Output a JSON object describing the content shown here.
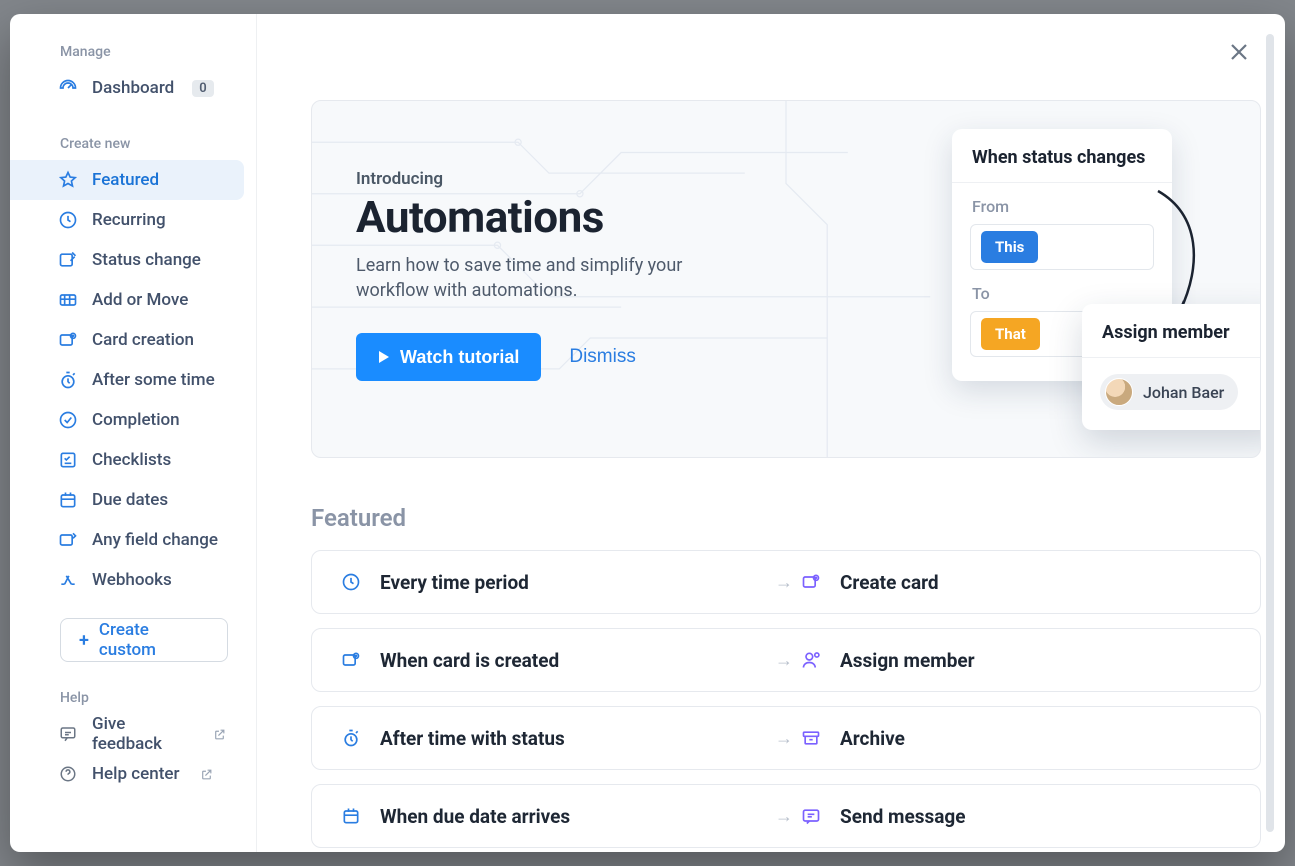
{
  "sidebar": {
    "sections": {
      "manage_label": "Manage",
      "create_label": "Create new",
      "help_label": "Help"
    },
    "dashboard": {
      "label": "Dashboard",
      "badge": "0"
    },
    "create_items": [
      {
        "id": "featured",
        "label": "Featured",
        "selected": true
      },
      {
        "id": "recurring",
        "label": "Recurring"
      },
      {
        "id": "status-change",
        "label": "Status change"
      },
      {
        "id": "add-or-move",
        "label": "Add or Move"
      },
      {
        "id": "card-creation",
        "label": "Card creation"
      },
      {
        "id": "after-some-time",
        "label": "After some time"
      },
      {
        "id": "completion",
        "label": "Completion"
      },
      {
        "id": "checklists",
        "label": "Checklists"
      },
      {
        "id": "due-dates",
        "label": "Due dates"
      },
      {
        "id": "any-field-change",
        "label": "Any field change"
      },
      {
        "id": "webhooks",
        "label": "Webhooks"
      }
    ],
    "create_custom": "Create custom",
    "help_items": [
      {
        "id": "give-feedback",
        "label": "Give feedback",
        "external": true
      },
      {
        "id": "help-center",
        "label": "Help center",
        "external": true
      }
    ]
  },
  "intro": {
    "eyebrow": "Introducing",
    "title": "Automations",
    "subtitle": "Learn how to save time and simplify your workflow with automations.",
    "watch_label": "Watch tutorial",
    "dismiss_label": "Dismiss",
    "illustration": {
      "panel1_title": "When status changes",
      "from_label": "From",
      "to_label": "To",
      "chip_this": "This",
      "chip_that": "That",
      "panel2_title": "Assign member",
      "member_name": "Johan Baer"
    }
  },
  "list": {
    "heading": "Featured",
    "rows": [
      {
        "trigger_icon": "clock",
        "trigger": "Every time period",
        "action_icon": "card-create",
        "action": "Create card",
        "action_color": "#7b61ff"
      },
      {
        "trigger_icon": "card-plus",
        "trigger": "When card is created",
        "action_icon": "assign",
        "action": "Assign member",
        "action_color": "#7b61ff"
      },
      {
        "trigger_icon": "stopwatch",
        "trigger": "After time with status",
        "action_icon": "archive",
        "action": "Archive",
        "action_color": "#7b61ff"
      },
      {
        "trigger_icon": "calendar",
        "trigger": "When due date arrives",
        "action_icon": "message",
        "action": "Send message",
        "action_color": "#7b61ff"
      }
    ]
  }
}
